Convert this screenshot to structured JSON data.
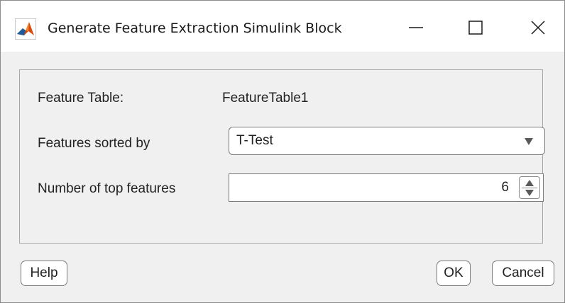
{
  "window": {
    "title": "Generate Feature Extraction Simulink Block",
    "app_icon": "matlab-logo",
    "controls": {
      "minimize_icon": "minimize-icon",
      "maximize_icon": "maximize-icon",
      "close_icon": "close-icon"
    }
  },
  "form": {
    "feature_table": {
      "label": "Feature Table:",
      "value": "FeatureTable1"
    },
    "sorted_by": {
      "label": "Features sorted by",
      "selected": "T-Test",
      "icon": "dropdown-arrow-icon"
    },
    "top_features": {
      "label": "Number of top features",
      "value": "6",
      "up_icon": "spinner-up-icon",
      "down_icon": "spinner-down-icon"
    }
  },
  "buttons": {
    "help": "Help",
    "ok": "OK",
    "cancel": "Cancel"
  },
  "colors": {
    "window_background": "#f0f0f0",
    "titlebar_background": "#ffffff",
    "border": "#7a7a7a",
    "logo_red": "#d9480f",
    "logo_blue": "#1c5c9c"
  }
}
